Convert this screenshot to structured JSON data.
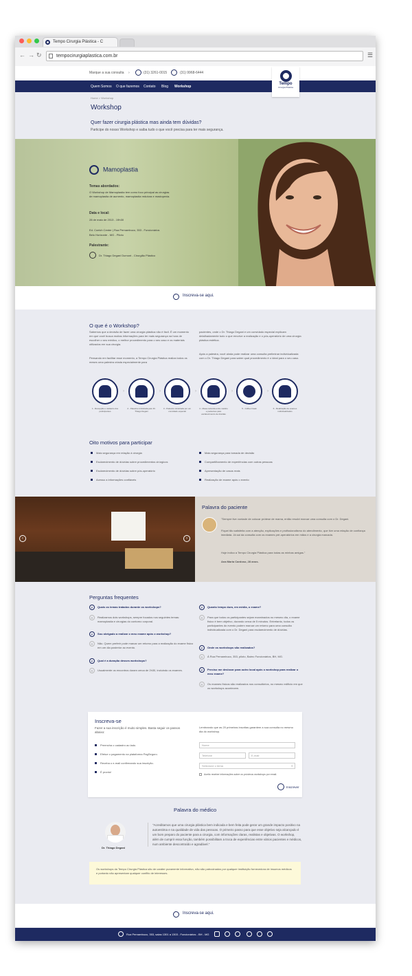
{
  "browser": {
    "tab_title": "Tempo Cirurgia Plástica - C",
    "url": "tempocirurgiaplastica.com.br"
  },
  "topbar": {
    "cta": "Marque a sua consulta",
    "phone1": "(31) 3261-0015",
    "phone2": "(31) 9968-6444"
  },
  "nav": [
    "Quem Somos",
    "O que fazemos",
    "Contato",
    "Blog",
    "Workshop"
  ],
  "logo": {
    "name": "Tempo",
    "tagline": "Cirurgia Plástica"
  },
  "breadcrumb": "Home  >  Workshop",
  "page": {
    "title": "Workshop",
    "headline": "Quer fazer cirurgia plástica mas ainda tem dúvidas?",
    "subtitle": "Participe do nosso Workshop e saiba tudo o que você precisa para ter mais segurança."
  },
  "hero": {
    "topic": "Mamoplastia",
    "themes_label": "Temas abordados:",
    "themes_text": "O Workshop de Mamoplastia tem como foco principal as cirurgias de mamoplastia de aumento, mamoplastia redutora e mastopexia.",
    "date_label": "Data e local:",
    "date": "28 de maio de 2013 - 19h30",
    "place1": "Ed. Coelch Center | Rua Pernambuco, 353 - Funcionários",
    "place2": "Belo Horizonte - MG - Piloto",
    "speaker_label": "Palestrante:",
    "speaker": "Dr. Thiago Degani Dumont - Cirurgião Plástico"
  },
  "cta": "Inscreva-se aqui.",
  "what": {
    "title": "O que é o Workshop?",
    "col1a": "Sabemos que a decisão de fazer uma cirurgia plástica não é fácil. É um momento em que você busca muitas informações para ter mais segurança na hora de escolher o seu médico, o melhor procedimento para o seu caso e os materiais utilizados em sua cirurgia.",
    "col1b": "Pensando em facilitar esse momento, a Tempo Cirurgia Plástica realiza todos os meses uma palestra criada especialmente para",
    "col2a": "pacientes, onde o Dr. Thiago Degani e um convidado especial explicam detalhadamente tudo o que envolve a realização e o pós-operatório de uma cirurgia plástica estética.",
    "col2b": "Após a palestra, você ainda pode realizar uma consulta preliminar individualizada com o Dr. Thiago Degani para saber qual procedimento é o ideal para o seu caso."
  },
  "steps": [
    "1 - Recepção e cadastro dos participantes",
    "2 - Palestra ministrada pelo Dr. Thiago Degani",
    "3 - Palestra ministrada por um convidado especial",
    "4 - Mesa redonda entre médico e pacientes para esclarecimento de dúvidas",
    "5 - Coffee break",
    "6 - Realização de exames individualizados"
  ],
  "reasons": {
    "title": "Oito motivos para participar",
    "left": [
      "Mais segurança em relação à cirurgia",
      "Esclarecimento de dúvidas sobre procedimentos cirúrgicos",
      "Esclarecimento de dúvidas sobre pós-operatório",
      "Acesso a informações confiáveis"
    ],
    "right": [
      "Mais segurança para tomada de decisão",
      "Compartilhamento de experiências com outras pessoas",
      "Apresentação de casos reais",
      "Realização de exame após o evento"
    ]
  },
  "patient": {
    "title": "Palavra do paciente",
    "q1": "\"Sempre tive vontade de colocar prótese de mama, então resolvi marcar uma consulta com o Dr. Degani.",
    "q2": "Fiquei tão satisfeita com a atenção, explicações e profissionalismo do atendimento, que tive uma relação de confiança imediata. Já sai da consulta com os exames pré-operatórios em mãos e a cirurgia marcada.",
    "q3": "Hoje indico a Tempo Cirurgia Plástica para todas as minhas amigas.\"",
    "author": "Ana Maria Cardoso, 28 anos."
  },
  "faq": {
    "title": "Perguntas frequentes",
    "items": [
      {
        "q": "Quais os temas tratados durante os workshops?",
        "a": "Realizamos dois workshops, sempre focados nos seguintes temas: mamoplastia e cirurgias do contorno corporal."
      },
      {
        "q": "Sou obrigado a realizar o meu exame após o workshop?",
        "a": "Não. Quem preferir pode marcar um retorno para a realização do exame físico em um dia posterior ao evento."
      },
      {
        "q": "Qual é a duração desses workshops?",
        "a": "Usualmente os encontros duram cerca de 2h30, incluindo os exames."
      },
      {
        "q": "Quanto tempo dura, em média, o exame?",
        "a": "Para que todos os participantes sejam examinados no mesmo dia, o exame físico é bem objetivo, durando cerca de 5 minutos. Entretanto, todos os participantes do evento podem marcar um retorno para uma consulta individualizada com o Dr. Degani para esclarecimento de dúvidas."
      },
      {
        "q": "Onde os workshops são realizados?",
        "a": "À Rua Pernambuco, 353, piloto, Bairro Funcionários, BH, MG."
      },
      {
        "q": "Preciso me deslocar para outro local após o workshop para realizar o meu exame?",
        "a": "Os exames físicos são realizados nos consultórios, no mesmo edifício em que os workshops acontecem."
      }
    ]
  },
  "signup": {
    "title": "Inscreva-se",
    "intro": "Fazer a sua inscrição é muito simples. Basta seguir os passos abaixo:",
    "steps": [
      "Preencha o cadastro ao lado.",
      "Efetue o pagamento na plataforma PagSeguro.",
      "Receba o e-mail confirmando sua inscrição.",
      "É pronto!"
    ],
    "remind": "Lembrando que as 20 primeiras inscritas garantem a sua consulta no mesmo dia do workshop.",
    "name_ph": "Nome",
    "phone_ph": "Telefone",
    "email_ph": "E-mail",
    "select": "Selecione o tema",
    "checkbox": "Aceito receber informações sobre os próximos workshops por email.",
    "submit": "Inscrever"
  },
  "doctor": {
    "title": "Palavra do médico",
    "name": "Dr. Thiago Degani",
    "quote": "\"Acreditamos que uma cirurgia plástica bem indicada e bem feita pode gerar um grande impacto positivo na autoestima e na qualidade de vida das pessoas. O primeiro passo para que esse objetivo seja alcançado é um bom preparo do paciente para a cirurgia, com informações claras, realistas e objetivas. O workshop, além de cumprir essa função, também possibilitam a troca de experiências entre vários pacientes e médicos, num ambiente descontraído e agradável.\""
  },
  "disclaimer": "Os workshops da Tempo Cirurgia Plástica são de caráter puramente informativo, não são patrocinados por qualquer instituição fornecedora de insumos médicos e portanto não apresentam qualquer conflito de interesses.",
  "footer": {
    "address": "Rua Pernambuco, 353, salas 1301 a 1303 - Funcionários - BH - MG"
  }
}
